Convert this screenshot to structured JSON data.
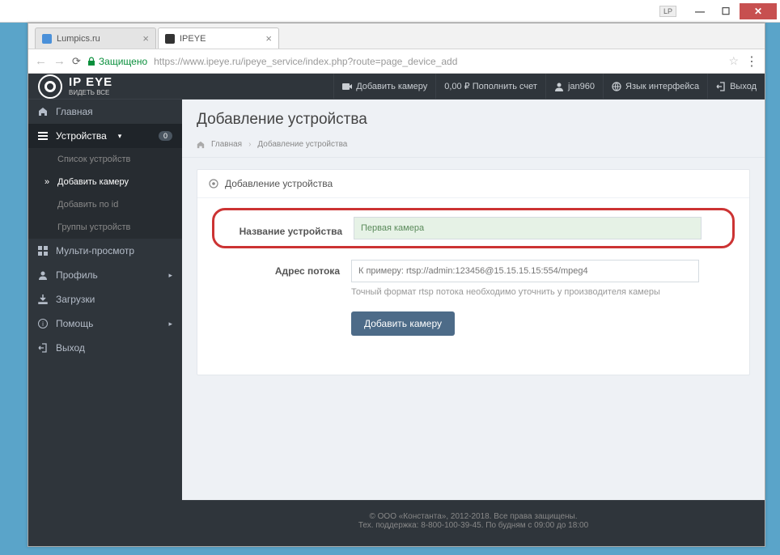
{
  "window": {
    "lp_badge": "LP"
  },
  "tabs": [
    {
      "title": "Lumpics.ru",
      "favicon": "#4a90d9"
    },
    {
      "title": "IPEYE",
      "favicon": "#333"
    }
  ],
  "addressbar": {
    "secure_label": "Защищено",
    "url_host": "https://www.ipeye.ru",
    "url_path": "/ipeye_service/index.php?route=page_device_add"
  },
  "topbar": {
    "logo_main": "IP EYE",
    "logo_sub": "ВИДЕТЬ ВСЕ",
    "add_camera": "Добавить камеру",
    "balance": "0,00 ₽ Пополнить счет",
    "user": "jan960",
    "lang": "Язык интерфейса",
    "logout": "Выход"
  },
  "sidebar": {
    "home": "Главная",
    "devices": "Устройства",
    "devices_badge": "0",
    "device_list": "Список устройств",
    "add_camera": "Добавить камеру",
    "add_by_id": "Добавить по id",
    "device_groups": "Группы устройств",
    "multi_view": "Мульти-просмотр",
    "profile": "Профиль",
    "downloads": "Загрузки",
    "help": "Помощь",
    "exit": "Выход"
  },
  "page": {
    "title": "Добавление устройства",
    "breadcrumb_home": "Главная",
    "breadcrumb_current": "Добавление устройства",
    "panel_title": "Добавление устройства",
    "form": {
      "name_label": "Название устройства",
      "name_value": "Первая камера",
      "stream_label": "Адрес потока",
      "stream_placeholder": "К примеру: rtsp://admin:123456@15.15.15.15:554/mpeg4",
      "stream_hint": "Точный формат rtsp потока необходимо уточнить у производителя камеры",
      "submit": "Добавить камеру"
    }
  },
  "footer": {
    "line1": "© ООО «Константа», 2012-2018. Все права защищены.",
    "line2": "Тех. поддержка: 8-800-100-39-45. По будням с 09:00 до 18:00"
  }
}
